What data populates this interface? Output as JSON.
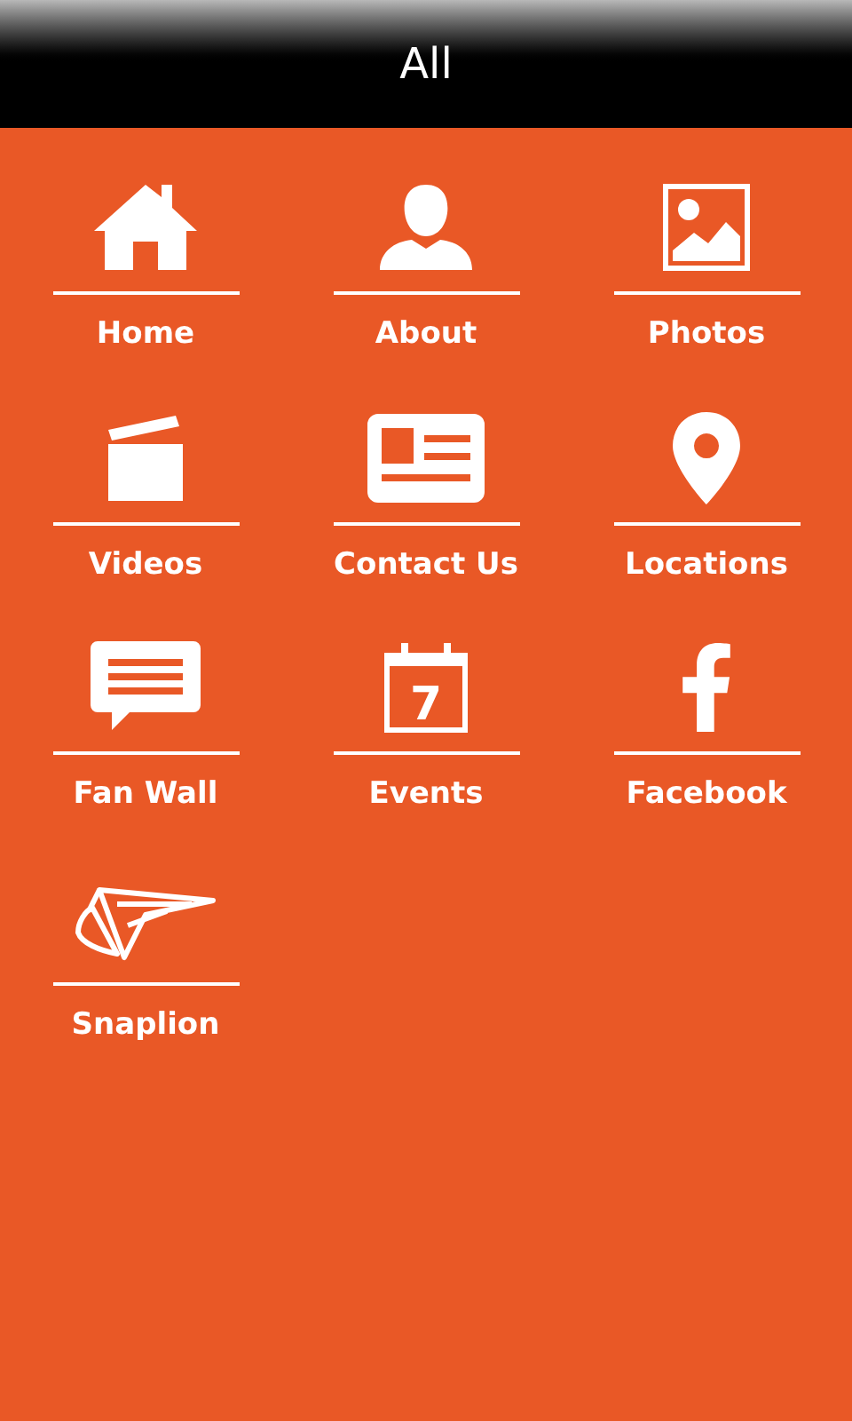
{
  "header": {
    "title": "All"
  },
  "items": [
    {
      "kind": "home",
      "label": "Home"
    },
    {
      "kind": "about",
      "label": "About"
    },
    {
      "kind": "photos",
      "label": "Photos"
    },
    {
      "kind": "videos",
      "label": "Videos"
    },
    {
      "kind": "contact",
      "label": "Contact Us"
    },
    {
      "kind": "locations",
      "label": "Locations"
    },
    {
      "kind": "fanwall",
      "label": "Fan Wall"
    },
    {
      "kind": "events",
      "label": "Events",
      "icon_text": "7"
    },
    {
      "kind": "facebook",
      "label": "Facebook"
    },
    {
      "kind": "snaplion",
      "label": "Snaplion"
    }
  ]
}
